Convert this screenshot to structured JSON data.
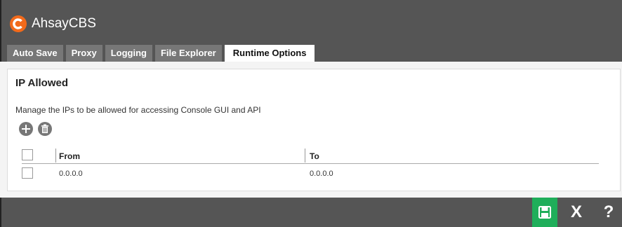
{
  "app": {
    "title": "AhsayCBS",
    "brand_color": "#f26a1b"
  },
  "tabs": [
    {
      "label": "Auto Save",
      "active": false
    },
    {
      "label": "Proxy",
      "active": false
    },
    {
      "label": "Logging",
      "active": false
    },
    {
      "label": "File Explorer",
      "active": false
    },
    {
      "label": "Runtime Options",
      "active": true
    }
  ],
  "section": {
    "title": "IP Allowed",
    "description": "Manage the IPs to be allowed for accessing Console GUI and API",
    "add_icon": "plus-icon",
    "delete_icon": "trash-icon"
  },
  "table": {
    "columns": [
      "From",
      "To"
    ],
    "rows": [
      {
        "from": "0.0.0.0",
        "to": "0.0.0.0",
        "checked": false
      }
    ]
  },
  "footer": {
    "save_icon": "floppy-disk-icon",
    "close_label": "X",
    "help_label": "?",
    "save_color": "#1fae5a"
  }
}
